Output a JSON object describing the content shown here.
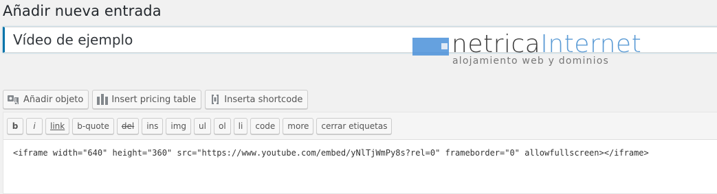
{
  "page": {
    "title": "Añadir nueva entrada"
  },
  "post": {
    "title_value": "Vídeo de ejemplo"
  },
  "watermark": {
    "brand_part1": "netrica",
    "brand_part2": "Internet",
    "tagline": "alojamiento web y dominios"
  },
  "media_buttons": [
    {
      "label": "Añadir objeto",
      "icon": "media-icon"
    },
    {
      "label": "Insert pricing table",
      "icon": "pricing-table-icon"
    },
    {
      "label": "Inserta shortcode",
      "icon": "shortcode-icon"
    }
  ],
  "quicktags": [
    "b",
    "i",
    "link",
    "b-quote",
    "del",
    "ins",
    "img",
    "ul",
    "ol",
    "li",
    "code",
    "more",
    "cerrar etiquetas"
  ],
  "content": {
    "text": "<iframe width=\"640\" height=\"360\" src=\"https://www.youtube.com/embed/yNlTjWmPy8s?rel=0\" frameborder=\"0\" allowfullscreen></iframe>"
  }
}
